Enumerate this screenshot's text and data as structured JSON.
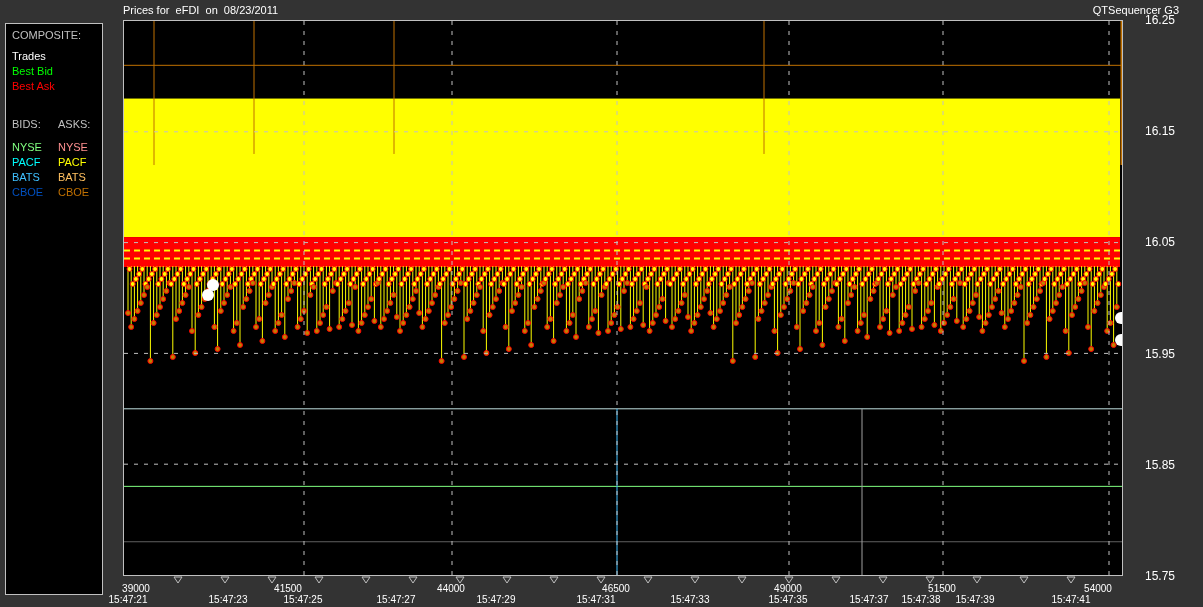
{
  "title": {
    "left": "Prices for  eFDI  on  08/23/2011",
    "right": "QTSequencer G3"
  },
  "legend": {
    "composite_heading": "COMPOSITE:",
    "composite": [
      {
        "label": "Trades",
        "color": "#ffffff"
      },
      {
        "label": "Best Bid",
        "color": "#00ff00"
      },
      {
        "label": "Best Ask",
        "color": "#ff0000"
      }
    ],
    "bids_heading": "BIDS:",
    "asks_heading": "ASKS:",
    "bids": [
      {
        "label": "NYSE",
        "color": "#80ff80"
      },
      {
        "label": "PACF",
        "color": "#00ffff"
      },
      {
        "label": "BATS",
        "color": "#40c0ff"
      },
      {
        "label": "CBOE",
        "color": "#0050c0"
      }
    ],
    "asks": [
      {
        "label": "NYSE",
        "color": "#ff9090"
      },
      {
        "label": "PACF",
        "color": "#ffff00"
      },
      {
        "label": "BATS",
        "color": "#ffc060"
      },
      {
        "label": "CBOE",
        "color": "#c07000"
      }
    ]
  },
  "chart": {
    "y_axis_labels": [
      "16.25",
      "16.15",
      "16.05",
      "15.95",
      "15.85",
      "15.75"
    ],
    "x_axis_sequence_labels": [
      "39000",
      "41500",
      "44000",
      "46500",
      "49000",
      "51500",
      "54000"
    ],
    "x_axis_time_labels": [
      "15:47:21",
      "15:47:23",
      "15:47:25",
      "15:47:27",
      "15:47:29",
      "15:47:31",
      "15:47:33",
      "15:47:35",
      "15:47:37",
      "15:47:38",
      "15:47:39",
      "15:47:41"
    ]
  }
}
